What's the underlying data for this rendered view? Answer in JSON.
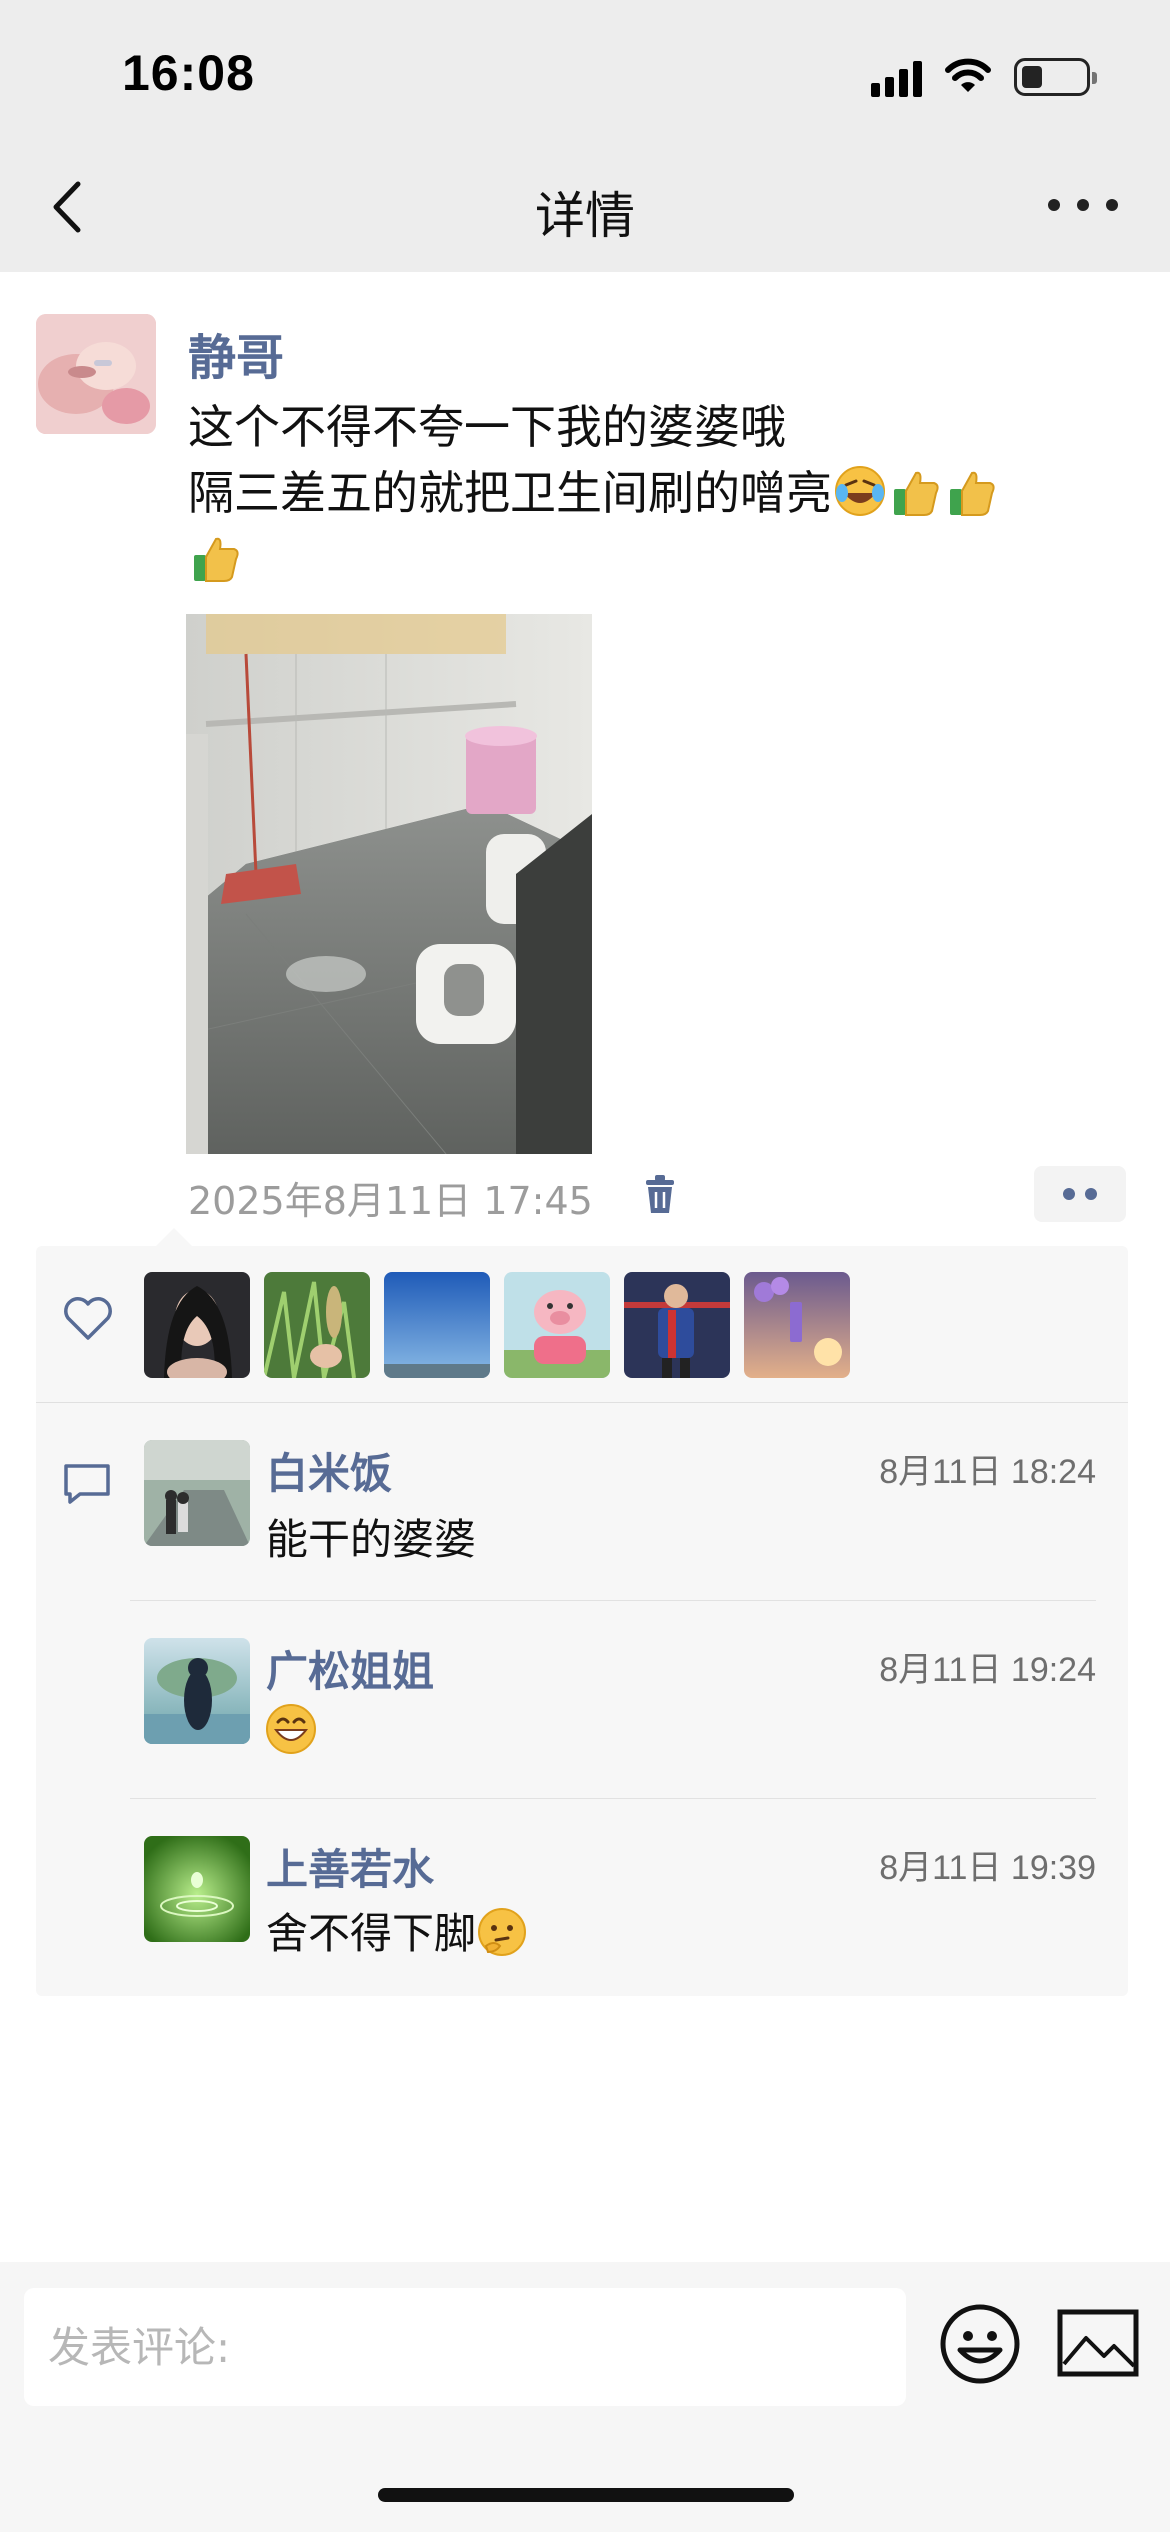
{
  "status_bar": {
    "time": "16:08"
  },
  "nav": {
    "title": "详情",
    "back_icon": "chevron-left-icon",
    "more_icon": "more-dots-icon"
  },
  "post": {
    "author": "静哥",
    "text_line1": "这个不得不夸一下我的婆婆哦",
    "text_line2": "隔三差五的就把卫生间刷的噌亮",
    "emojis": [
      "rofl-emoji",
      "thumbs-up-emoji",
      "thumbs-up-emoji",
      "thumbs-up-emoji"
    ],
    "timestamp": "2025年8月11日 17:45"
  },
  "likes": {
    "icon": "heart-icon",
    "avatars": [
      "liker-avatar-1",
      "liker-avatar-2",
      "liker-avatar-3",
      "liker-avatar-4",
      "liker-avatar-5",
      "liker-avatar-6"
    ]
  },
  "comments": [
    {
      "name": "白米饭",
      "time": "8月11日 18:24",
      "text": "能干的婆婆",
      "emoji": ""
    },
    {
      "name": "广松姐姐",
      "time": "8月11日 19:24",
      "text": "",
      "emoji": "grinning-emoji"
    },
    {
      "name": "上善若水",
      "time": "8月11日 19:39",
      "text": "舍不得下脚",
      "emoji": "thinking-emoji"
    }
  ],
  "composer": {
    "placeholder": "发表评论:"
  }
}
